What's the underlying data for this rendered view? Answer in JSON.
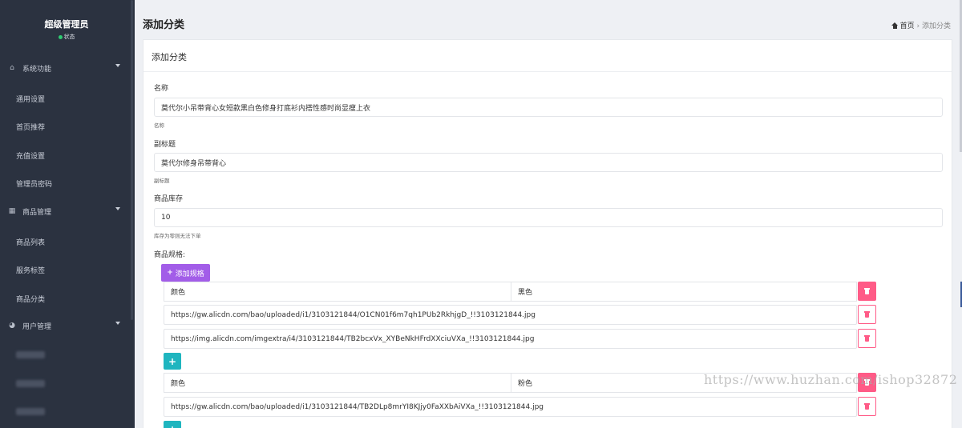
{
  "sidebar": {
    "user_name": "超级管理员",
    "user_status": "状态",
    "groups": [
      {
        "label": "系统功能",
        "icon": "home-icon"
      },
      {
        "label": "商品管理",
        "icon": "table-icon"
      },
      {
        "label": "用户管理",
        "icon": "pie-chart-icon"
      }
    ],
    "items": [
      "通用设置",
      "首页推荐",
      "充值设置",
      "管理员密码",
      "商品列表",
      "服务标签",
      "商品分类"
    ]
  },
  "header": {
    "page_title": "添加分类",
    "breadcrumb_home": "首页",
    "breadcrumb_sep": "›",
    "breadcrumb_current": "添加分类"
  },
  "card": {
    "title": "添加分类"
  },
  "form": {
    "name_label": "名称",
    "name_value": "莫代尔小吊带背心女短款黑白色修身打底衫内搭性感时尚显瘦上衣",
    "name_help": "名称",
    "subtitle_label": "副标题",
    "subtitle_value": "莫代尔修身吊带背心",
    "subtitle_help": "副标题",
    "stock_label": "商品库存",
    "stock_value": "10",
    "stock_help": "库存为零则无法下单",
    "spec_label": "商品规格:",
    "add_spec_label": "添加规格",
    "add_spec_icon": "plus-icon"
  },
  "specs": [
    {
      "key": "颜色",
      "value": "黑色",
      "images": [
        "https://gw.alicdn.com/bao/uploaded/i1/3103121844/O1CN01f6m7qh1PUb2RkhjgD_!!3103121844.jpg",
        "https://img.alicdn.com/imgextra/i4/3103121844/TB2bcxVx_XYBeNkHFrdXXciuVXa_!!3103121844.jpg"
      ]
    },
    {
      "key": "颜色",
      "value": "粉色",
      "images": [
        "https://gw.alicdn.com/bao/uploaded/i1/3103121844/TB2DLp8mrYI8KJjy0FaXXbAiVXa_!!3103121844.jpg"
      ]
    }
  ],
  "watermark": "https://www.huzhan.com/ishop32872",
  "colors": {
    "sidebar_bg": "#2b3240",
    "add_spec_purple": "#a25de8",
    "delete_pink": "#ff5b87",
    "add_image_teal": "#1fb5bf",
    "status_green": "#2ecc71"
  }
}
